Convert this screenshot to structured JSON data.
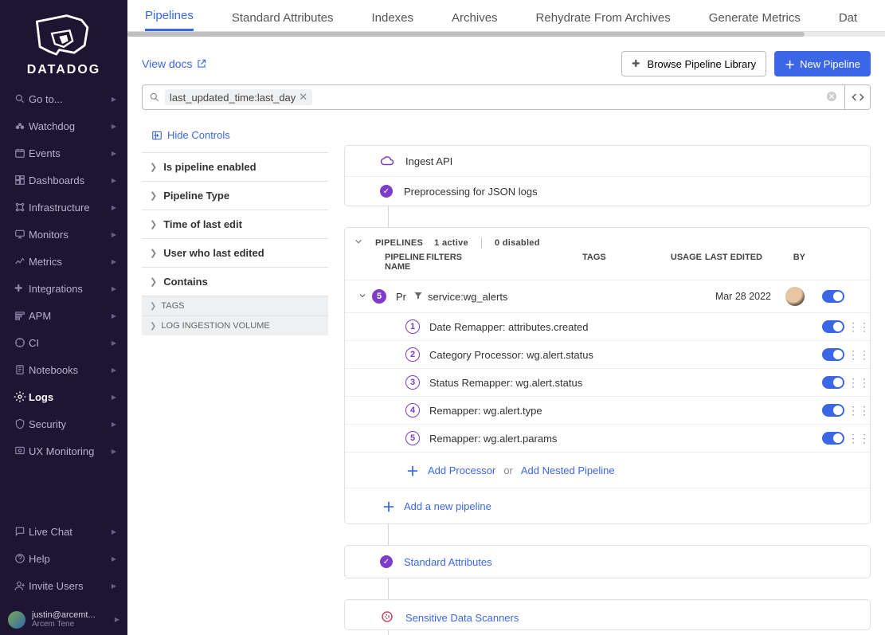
{
  "brand": "DATADOG",
  "nav": {
    "items": [
      {
        "icon": "search",
        "label": "Go to..."
      },
      {
        "icon": "binoculars",
        "label": "Watchdog"
      },
      {
        "icon": "calendar",
        "label": "Events"
      },
      {
        "icon": "dashboard",
        "label": "Dashboards"
      },
      {
        "icon": "infrastructure",
        "label": "Infrastructure"
      },
      {
        "icon": "monitor",
        "label": "Monitors"
      },
      {
        "icon": "metrics",
        "label": "Metrics"
      },
      {
        "icon": "integrations",
        "label": "Integrations"
      },
      {
        "icon": "apm",
        "label": "APM"
      },
      {
        "icon": "ci",
        "label": "CI"
      },
      {
        "icon": "notebook",
        "label": "Notebooks"
      },
      {
        "icon": "logs",
        "label": "Logs",
        "active": true
      },
      {
        "icon": "security",
        "label": "Security"
      },
      {
        "icon": "ux",
        "label": "UX Monitoring"
      }
    ],
    "bottom": [
      {
        "icon": "chat",
        "label": "Live Chat"
      },
      {
        "icon": "help",
        "label": "Help"
      },
      {
        "icon": "invite",
        "label": "Invite Users"
      }
    ],
    "user": {
      "email": "justin@arcemt...",
      "org": "Arcem Tene"
    }
  },
  "tabs": [
    "Pipelines",
    "Standard Attributes",
    "Indexes",
    "Archives",
    "Rehydrate From Archives",
    "Generate Metrics",
    "Dat"
  ],
  "active_tab": 0,
  "toolbar": {
    "view_docs": "View docs",
    "browse_library": "Browse Pipeline Library",
    "new_pipeline": "New Pipeline"
  },
  "search": {
    "chip": "last_updated_time:last_day"
  },
  "controls": {
    "hide": "Hide Controls",
    "facets": [
      "Is pipeline enabled",
      "Pipeline Type",
      "Time of last edit",
      "User who last edited",
      "Contains"
    ],
    "sub": [
      "TAGS",
      "LOG INGESTION VOLUME"
    ]
  },
  "stage": {
    "ingest": "Ingest API",
    "preprocess": "Preprocessing for JSON logs"
  },
  "summary": {
    "pipelines_label": "PIPELINES",
    "active": "1 active",
    "disabled": "0 disabled"
  },
  "columns": {
    "name": "PIPELINE NAME",
    "filters": "FILTERS",
    "tags": "TAGS",
    "usage": "USAGE",
    "edited": "LAST EDITED",
    "by": "BY"
  },
  "pipeline": {
    "count": "5",
    "name_preview": "Pr",
    "filter": "service:wg_alerts",
    "date": "Mar 28 2022",
    "processors": [
      "Date Remapper: attributes.created",
      "Category Processor: wg.alert.status",
      "Status Remapper: wg.alert.status",
      "Remapper: wg.alert.type",
      "Remapper: wg.alert.params"
    ],
    "add_processor": "Add Processor",
    "or": "or",
    "add_nested": "Add Nested Pipeline",
    "add_new": "Add a new pipeline"
  },
  "footer_cards": {
    "standard_attributes": "Standard Attributes",
    "sensitive": "Sensitive Data Scanners"
  }
}
